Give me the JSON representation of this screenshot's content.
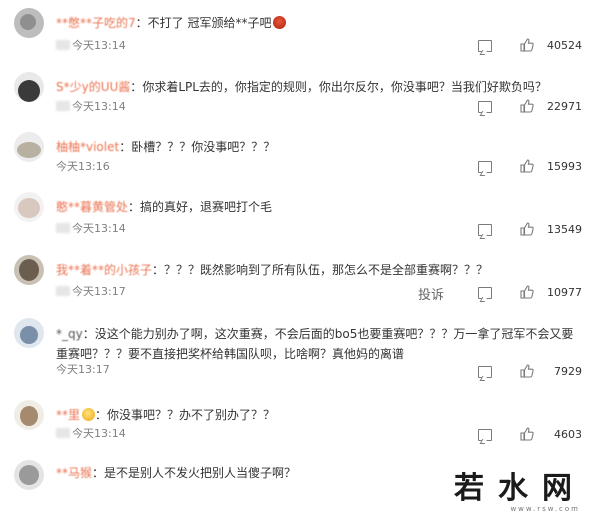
{
  "comments": [
    {
      "username": "**憋**子吃的7",
      "text": "不打了 冠军颁给**子吧",
      "time": "今天13:14",
      "likes": "40524"
    },
    {
      "username": "S*少y的UU酱",
      "text": "你求着LPL去的，你指定的规则，你出尔反尔，你没事吧？当我们好欺负吗？",
      "time": "今天13:14",
      "likes": "22971"
    },
    {
      "username": "柚柚*violet",
      "text": "卧槽？？？你没事吧？？？",
      "time": "今天13:16",
      "likes": "15993"
    },
    {
      "username": "憨**暮黄管处",
      "text": "搞的真好，退赛吧打个毛",
      "time": "今天13:14",
      "likes": "13549"
    },
    {
      "username": "我**着**的小孩子",
      "text": "？？？既然影响到了所有队伍，那怎么不是全部重赛啊？？？",
      "time": "今天13:17",
      "likes": "10977",
      "report": "投诉"
    },
    {
      "username": "*_qy",
      "text": "没这个能力别办了啊，这次重赛，不会后面的bo5也要重赛吧？？？万一拿了冠军不会又要重赛吧？？？要不直接把奖杯给韩国队呗，比啥啊？真他妈的离谱",
      "time": "今天13:17",
      "likes": "7929"
    },
    {
      "username": "**里",
      "text": "你没事吧？？办不了别办了？？",
      "time": "今天13:14",
      "likes": "4603"
    },
    {
      "username": "**马猴",
      "text": "是不是别人不发火把别人当傻子啊？",
      "time": "",
      "likes": ""
    }
  ],
  "watermark": {
    "main": "若水网",
    "sub": "www.rsw.com"
  },
  "colors": {
    "username": "#eb7350",
    "text": "#333333",
    "meta": "#808080"
  }
}
